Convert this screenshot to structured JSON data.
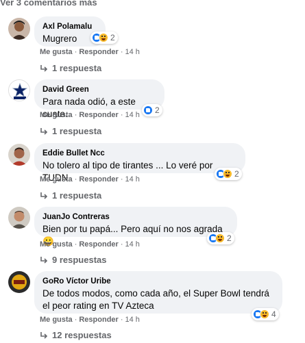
{
  "view_more": "Ver 3 comentarios más",
  "labels": {
    "like": "Me gusta",
    "reply": "Responder",
    "separator": "·"
  },
  "colors": {
    "bubble": "#f0f2f5",
    "meta": "#65676b",
    "like_blue": "#1877f2",
    "haha_yellow": "#f7b928"
  },
  "comments": [
    {
      "author": "Axl Polamalu",
      "text": "Mugrero",
      "time": "14 h",
      "reactions": [
        "like-icon",
        "haha-icon"
      ],
      "reaction_count": "2",
      "replies": "1 respuesta"
    },
    {
      "author": "David Green",
      "text": "Para nada odió, a este cuate.",
      "time": "14 h",
      "reactions": [
        "like-icon"
      ],
      "reaction_count": "2",
      "replies": "1 respuesta"
    },
    {
      "author": "Eddie Bullet Ncc",
      "text": "No tolero al tipo de tirantes ... Lo veré por TUDN",
      "time": "14 h",
      "reactions": [
        "like-icon",
        "haha-icon"
      ],
      "reaction_count": "2",
      "replies": "1 respuesta"
    },
    {
      "author": "JuanJo Contreras",
      "text": "Bien por tu papá... Pero aquí no nos agrada 😀",
      "time": "14 h",
      "reactions": [
        "like-icon",
        "haha-icon"
      ],
      "reaction_count": "2",
      "replies": "9 respuestas"
    },
    {
      "author": "GoRo Víctor Uribe",
      "text": "De todos modos, como cada año, el Super Bowl tendrá el peor rating en TV Azteca",
      "time": "14 h",
      "reactions": [
        "like-icon",
        "haha-icon"
      ],
      "reaction_count": "4",
      "replies": "12 respuestas"
    }
  ]
}
